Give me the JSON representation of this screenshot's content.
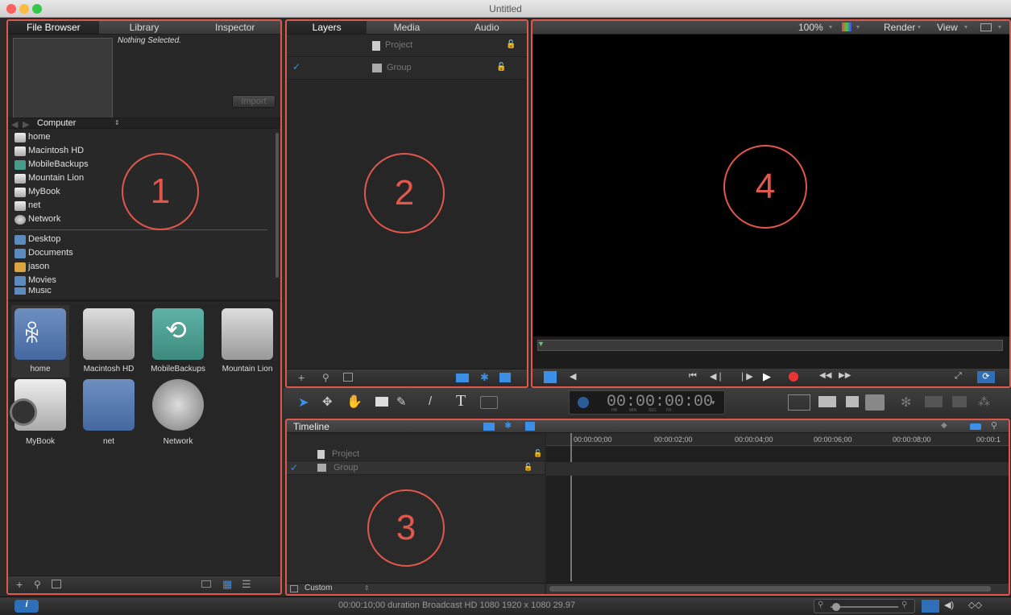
{
  "window": {
    "title": "Untitled"
  },
  "left_pane": {
    "tabs": [
      "File Browser",
      "Library",
      "Inspector"
    ],
    "preview_text": "Nothing Selected.",
    "import_button": "Import",
    "location": "Computer",
    "devices": [
      {
        "label": "home",
        "icon": "home-drive-icon"
      },
      {
        "label": "Macintosh HD",
        "icon": "hard-drive-icon"
      },
      {
        "label": "MobileBackups",
        "icon": "time-machine-icon"
      },
      {
        "label": "Mountain Lion",
        "icon": "hard-drive-icon"
      },
      {
        "label": "MyBook",
        "icon": "external-drive-icon"
      },
      {
        "label": "net",
        "icon": "network-drive-icon"
      },
      {
        "label": "Network",
        "icon": "globe-icon"
      }
    ],
    "places": [
      {
        "label": "Desktop",
        "icon": "folder-icon"
      },
      {
        "label": "Documents",
        "icon": "folder-icon"
      },
      {
        "label": "jason",
        "icon": "home-icon"
      },
      {
        "label": "Movies",
        "icon": "folder-icon"
      },
      {
        "label": "Music",
        "icon": "folder-icon"
      }
    ],
    "grid_items": [
      "home",
      "Macintosh HD",
      "MobileBackups",
      "Mountain Lion",
      "MyBook",
      "net",
      "Network"
    ],
    "number": "1"
  },
  "layers_pane": {
    "tabs": [
      "Layers",
      "Media",
      "Audio"
    ],
    "rows": [
      "Project",
      "Group"
    ],
    "number": "2"
  },
  "viewer": {
    "zoom": "100%",
    "render_menu": "Render",
    "view_menu": "View",
    "number": "4"
  },
  "toolbar": {
    "timecode": "00:00:00:00",
    "timecode_units": [
      "HR",
      "MIN",
      "SEC",
      "FR"
    ]
  },
  "timeline": {
    "title": "Timeline",
    "rows": [
      "Project",
      "Group"
    ],
    "ruler": [
      "00:00:00;00",
      "00:00:02;00",
      "00:00:04;00",
      "00:00:06;00",
      "00:00:08;00",
      "00:00:1"
    ],
    "custom_label": "Custom",
    "number": "3"
  },
  "status": {
    "text": "00:00:10;00 duration Broadcast HD 1080 1920 x 1080 29.97"
  },
  "colors": {
    "accent_red": "#e2574c",
    "accent_blue": "#3b8fe6"
  }
}
